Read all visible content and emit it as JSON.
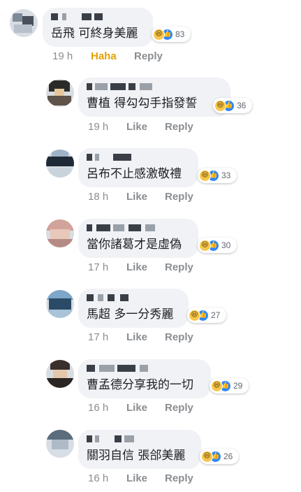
{
  "comments": [
    {
      "text": "岳飛 可終身美麗",
      "count": "83",
      "time": "19 h",
      "reaction_label": "Haha",
      "reply": "Reply"
    },
    {
      "text": "曹植 得勾勾手指發誓",
      "count": "36",
      "time": "19 h",
      "reaction_label": "Like",
      "reply": "Reply"
    },
    {
      "text": "呂布不止感激敬禮",
      "count": "33",
      "time": "18 h",
      "reaction_label": "Like",
      "reply": "Reply"
    },
    {
      "text": "當你諸葛才是虛偽",
      "count": "30",
      "time": "17 h",
      "reaction_label": "Like",
      "reply": "Reply"
    },
    {
      "text": "馬超 多一分秀麗",
      "count": "27",
      "time": "17 h",
      "reaction_label": "Like",
      "reply": "Reply"
    },
    {
      "text": "曹孟德分享我的一切",
      "count": "29",
      "time": "16 h",
      "reaction_label": "Like",
      "reply": "Reply"
    },
    {
      "text": "關羽自信 張郃美麗",
      "count": "26",
      "time": "16 h",
      "reaction_label": "Like",
      "reply": "Reply"
    }
  ],
  "icons": {
    "reaction_haha": "haha-emoji-icon",
    "reaction_like": "thumbs-up-icon"
  },
  "colors": {
    "bubble": "#f0f2f5",
    "like": "#2d88ff",
    "haha": "#e3a100",
    "meta": "#8a8d91"
  }
}
